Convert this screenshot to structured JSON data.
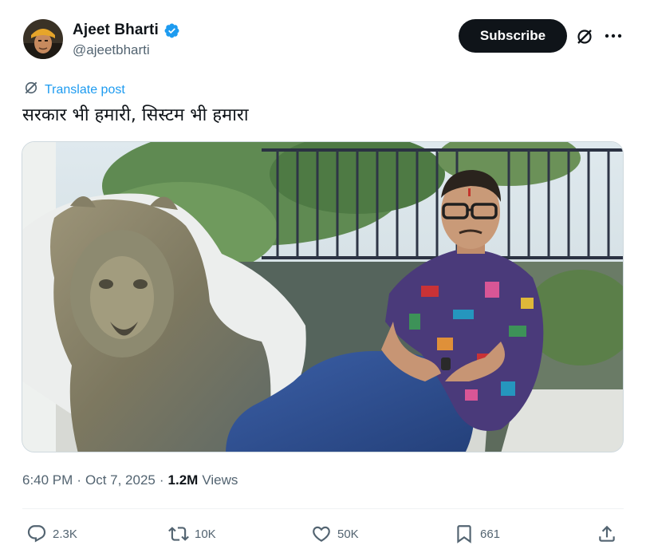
{
  "author": {
    "display_name": "Ajeet Bharti",
    "handle": "@ajeetbharti",
    "verified": true
  },
  "header_actions": {
    "subscribe_label": "Subscribe",
    "grok_icon": "grok-icon",
    "more_icon": "more-icon"
  },
  "post": {
    "translate_label": "Translate post",
    "text": "सरकार भी हमारी, सिस्टम भी हमारा",
    "time": "6:40 PM",
    "separator": "·",
    "date": "Oct 7, 2025",
    "views_count": "1.2M",
    "views_label": "Views"
  },
  "actions": {
    "replies": "2.3K",
    "reposts": "10K",
    "likes": "50K",
    "bookmarks": "661"
  },
  "colors": {
    "accent": "#1d9bf0",
    "text_primary": "#0f1419",
    "text_secondary": "#536471",
    "button_dark": "#0f1419"
  }
}
